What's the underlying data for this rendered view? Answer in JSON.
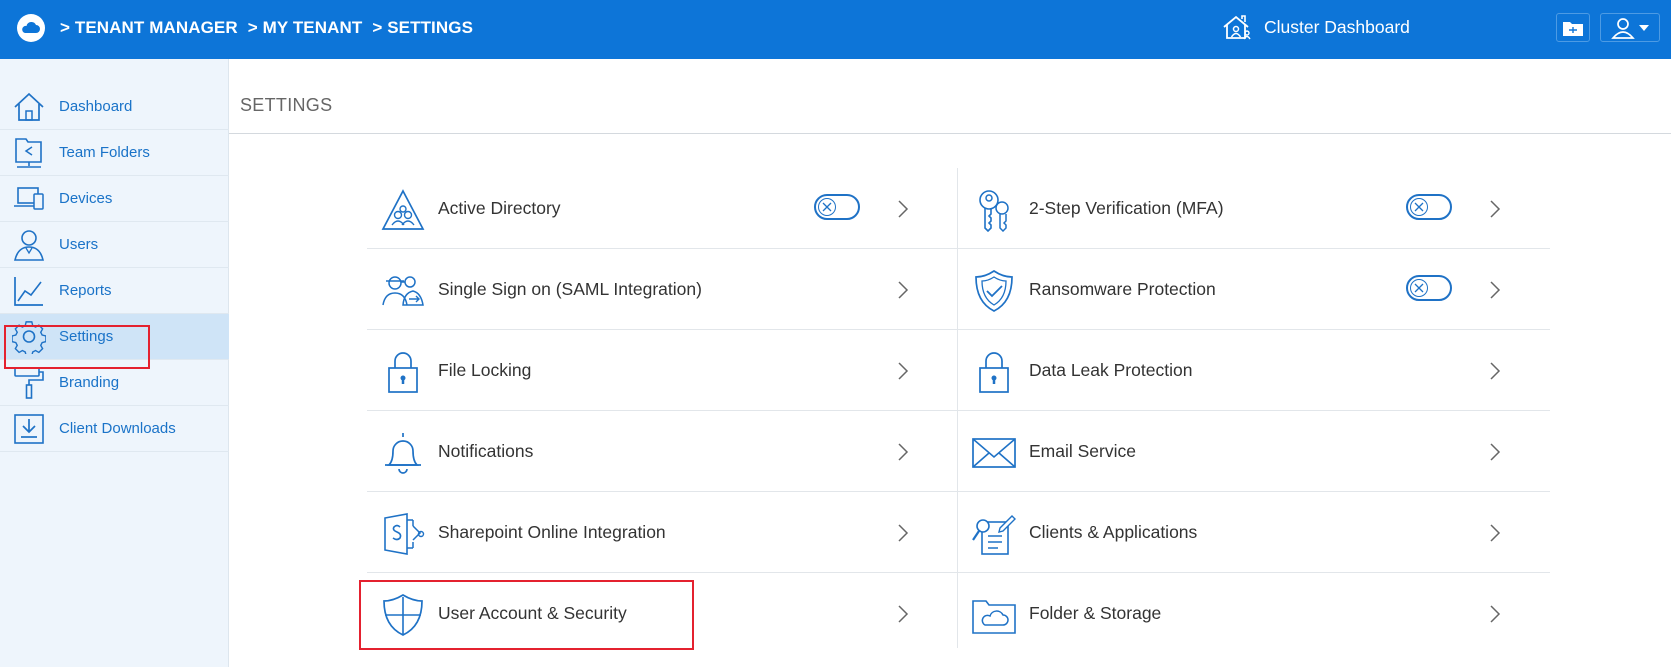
{
  "header": {
    "breadcrumb": [
      "> TENANT MANAGER",
      "> MY TENANT",
      "> SETTINGS"
    ],
    "cluster_label": "Cluster Dashboard"
  },
  "sidebar": {
    "items": [
      {
        "label": "Dashboard",
        "icon": "home-icon"
      },
      {
        "label": "Team Folders",
        "icon": "team-folders-icon"
      },
      {
        "label": "Devices",
        "icon": "devices-icon"
      },
      {
        "label": "Users",
        "icon": "user-icon"
      },
      {
        "label": "Reports",
        "icon": "reports-icon"
      },
      {
        "label": "Settings",
        "icon": "gear-icon",
        "active": true
      },
      {
        "label": "Branding",
        "icon": "paint-roller-icon"
      },
      {
        "label": "Client Downloads",
        "icon": "download-icon"
      }
    ]
  },
  "main": {
    "title": "SETTINGS",
    "left_column": [
      {
        "label": "Active Directory",
        "icon": "active-directory-icon",
        "toggle": "off"
      },
      {
        "label": "Single Sign on (SAML Integration)",
        "icon": "sso-icon"
      },
      {
        "label": "File Locking",
        "icon": "lock-icon"
      },
      {
        "label": "Notifications",
        "icon": "bell-icon"
      },
      {
        "label": "Sharepoint Online Integration",
        "icon": "sharepoint-icon"
      },
      {
        "label": "User Account & Security",
        "icon": "shield-cross-icon"
      }
    ],
    "right_column": [
      {
        "label": "2-Step Verification (MFA)",
        "icon": "keys-icon",
        "toggle": "off"
      },
      {
        "label": "Ransomware Protection",
        "icon": "shield-check-icon",
        "toggle": "off"
      },
      {
        "label": "Data Leak Protection",
        "icon": "lock-icon"
      },
      {
        "label": "Email Service",
        "icon": "envelope-icon"
      },
      {
        "label": "Clients & Applications",
        "icon": "clients-apps-icon"
      },
      {
        "label": "Folder & Storage",
        "icon": "folder-cloud-icon"
      }
    ]
  },
  "colors": {
    "brand": "#0d75d8",
    "icon_blue": "#1f72c6",
    "highlight": "#e4212f",
    "sidebar_bg": "#eef5fc",
    "sidebar_active": "#cfe4f7"
  }
}
